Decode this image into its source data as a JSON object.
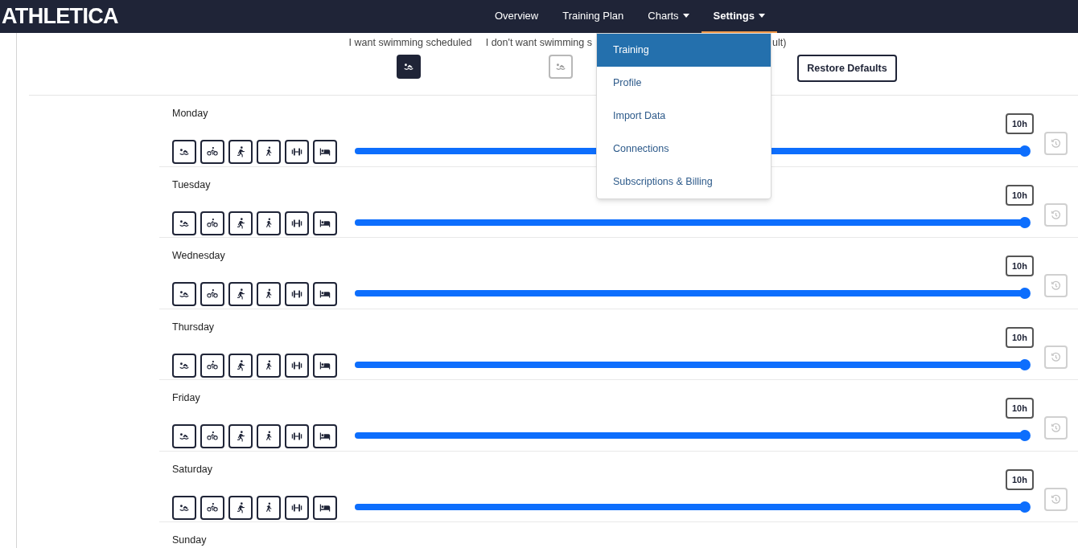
{
  "nav": {
    "logo": "ATHLETICA",
    "items": [
      {
        "label": "Overview",
        "dropdown": false,
        "selected": false
      },
      {
        "label": "Training Plan",
        "dropdown": false,
        "selected": false
      },
      {
        "label": "Charts",
        "dropdown": true,
        "selected": false
      },
      {
        "label": "Settings",
        "dropdown": true,
        "selected": true
      }
    ]
  },
  "settings_menu": {
    "items": [
      {
        "label": "Training",
        "selected": true
      },
      {
        "label": "Profile",
        "selected": false
      },
      {
        "label": "Import Data",
        "selected": false
      },
      {
        "label": "Connections",
        "selected": false
      },
      {
        "label": "Subscriptions & Billing",
        "selected": false
      }
    ]
  },
  "swimming": {
    "options": [
      {
        "label": "I want swimming scheduled",
        "selected": true
      },
      {
        "label": "I don't want swimming s",
        "label_end": "ult)",
        "selected": false
      }
    ],
    "restore_button": "Restore Defaults"
  },
  "days": [
    {
      "name": "Monday",
      "level": 1,
      "reading": "10h"
    },
    {
      "name": "Tuesday",
      "level": 1,
      "reading": "10h"
    },
    {
      "name": "Wednesday",
      "level": 1,
      "reading": "10h"
    },
    {
      "name": "Thursday",
      "level": 1,
      "reading": "10h"
    },
    {
      "name": "Friday",
      "level": 1,
      "reading": "10h"
    },
    {
      "name": "Saturday",
      "level": 1,
      "reading": "10h"
    },
    {
      "name": "Sunday"
    }
  ],
  "activities": [
    {
      "kind": "swim"
    },
    {
      "kind": "bike"
    },
    {
      "kind": "run"
    },
    {
      "kind": "walk"
    },
    {
      "kind": "strength"
    },
    {
      "kind": "rest"
    }
  ]
}
